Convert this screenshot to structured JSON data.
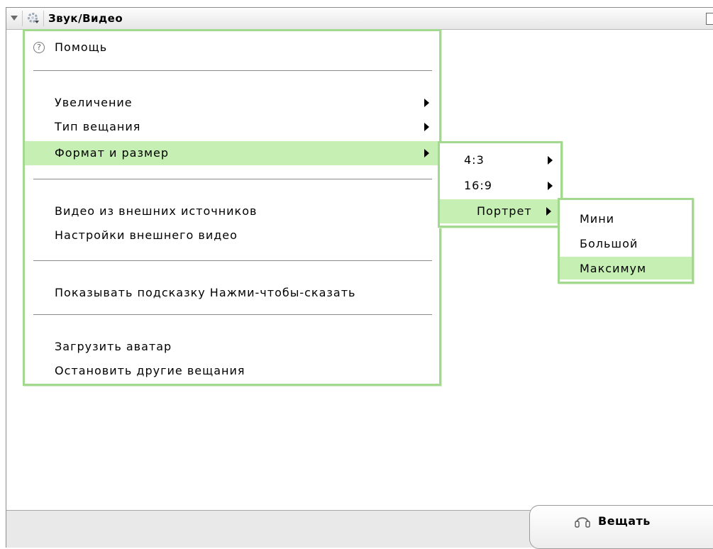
{
  "window": {
    "title": "Звук/Видео"
  },
  "main_menu": {
    "help": "Помощь",
    "zoom": "Увеличение",
    "broadcast_type": "Тип вещания",
    "format_size": "Формат и размер",
    "external_video": "Видео из внешних источников",
    "external_video_settings": "Настройки внешнего видео",
    "show_ptt_hint": "Показывать подсказку Нажми-чтобы-сказать",
    "upload_avatar": "Загрузить аватар",
    "stop_other_broadcasts": "Остановить другие вещания"
  },
  "format_submenu": {
    "items": [
      "4:3",
      "16:9",
      "Портрет"
    ],
    "selected": "Портрет"
  },
  "size_submenu": {
    "items": [
      "Мини",
      "Большой",
      "Максимум"
    ],
    "selected": "Максимум"
  },
  "bottom": {
    "broadcast_button": "Вещать"
  },
  "colors": {
    "menu_border": "#a3d98f",
    "menu_highlight": "#c6f0b3"
  },
  "icons": {
    "title_collapse": "triangle-down-icon",
    "title_settings": "gear-icon",
    "help": "question-circle-icon",
    "submenu": "triangle-right-icon",
    "broadcast": "headset-icon"
  }
}
